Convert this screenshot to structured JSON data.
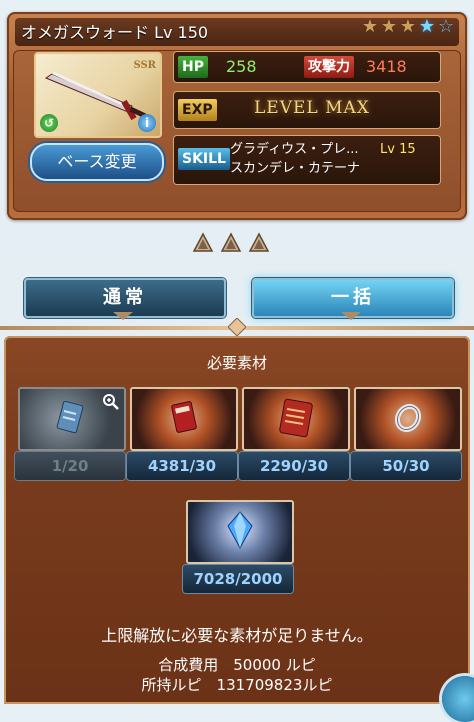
{
  "weapon": {
    "name": "オメガスウォード Lv 150",
    "rarity": "SSR",
    "uncap_stars_filled": 3,
    "uncap_stars_blue": 1,
    "uncap_stars_total": 5,
    "element_icon": "wind-icon",
    "info_icon": "info-icon"
  },
  "stats": {
    "hp_label": "HP",
    "hp_value": "258",
    "atk_label": "攻撃力",
    "atk_value": "3418",
    "exp_label": "EXP",
    "exp_value": "LEVEL MAX",
    "skill_label": "SKILL",
    "skill_line1": "グラディウス・プレ...",
    "skill_level": "Lv 15",
    "skill_line2": "スカンデレ・カテーナ"
  },
  "base_change_label": "ベース変更",
  "tabs": [
    {
      "label": "通常"
    },
    {
      "label": "一括"
    }
  ],
  "materials_title": "必要素材",
  "materials": [
    {
      "icon": "blue-card-icon",
      "count": "1/20",
      "sufficient": false
    },
    {
      "icon": "red-book-icon",
      "count": "4381/30",
      "sufficient": true
    },
    {
      "icon": "red-scroll-icon",
      "count": "2290/30",
      "sufficient": true
    },
    {
      "icon": "silver-ring-icon",
      "count": "50/30",
      "sufficient": true
    },
    {
      "icon": "blue-crystal-icon",
      "count": "7028/2000",
      "sufficient": true
    }
  ],
  "messages": {
    "insufficient": "上限解放に必要な素材が足りません。",
    "cost_line": "合成費用　50000 ルピ",
    "owned_line": "所持ルピ　131709823ルピ"
  },
  "colors": {
    "accent_blue": "#7fd6ff",
    "hp_green": "#8ef06a",
    "atk_red": "#ff7b5a",
    "skill_yellow": "#ffe466",
    "panel_brown": "#7a3c1d"
  }
}
